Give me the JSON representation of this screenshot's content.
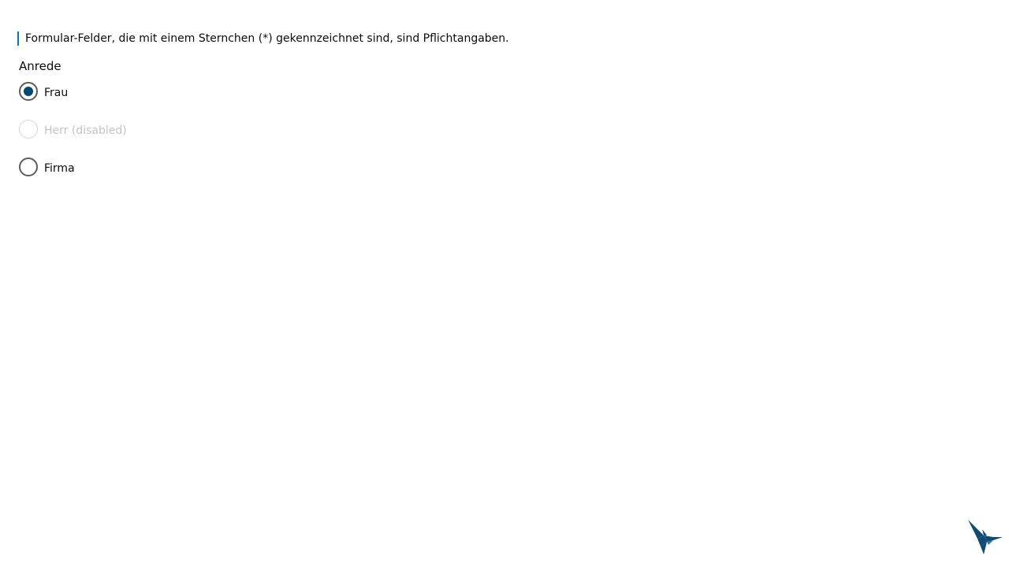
{
  "form": {
    "required_notice": "Formular-Felder, die mit einem Sternchen (*) gekennzeichnet sind, sind Pflichtangaben.",
    "salutation": {
      "legend": "Anrede",
      "options": [
        {
          "label": "Frau",
          "checked": true,
          "disabled": false
        },
        {
          "label": "Herr (disabled)",
          "checked": false,
          "disabled": true
        },
        {
          "label": "Firma",
          "checked": false,
          "disabled": false
        }
      ]
    }
  },
  "colors": {
    "accent": "#004b76",
    "notice_bar": "#0077b6",
    "radio_border": "#5c5c5c",
    "disabled": "#c4c4c4"
  },
  "brand": {
    "logo_icon": "hummingbird-logo-icon"
  }
}
